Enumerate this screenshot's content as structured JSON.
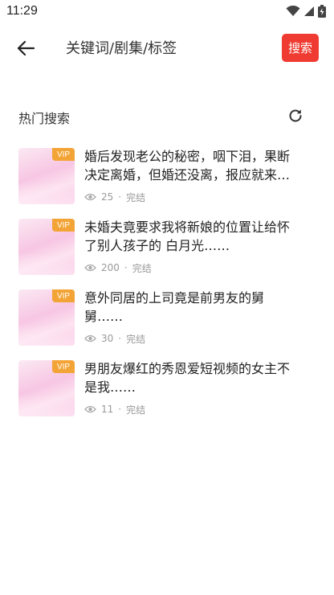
{
  "status": {
    "time": "11:29",
    "icons": [
      "wifi-icon",
      "signal-icon",
      "battery-icon"
    ]
  },
  "search": {
    "placeholder": "关键词/剧集/标签",
    "button_label": "搜索",
    "accent_color": "#ef3b32"
  },
  "hot": {
    "title": "热门搜索",
    "items": [
      {
        "title": "婚后发现老公的秘密，咽下泪，果断决定离婚，但婚还没离，报应就来…",
        "views": "25",
        "sep": "·",
        "status": "完结",
        "badge": "VIP"
      },
      {
        "title": "未婚夫竟要求我将新娘的位置让给怀了别人孩子的 白月光……",
        "views": "200",
        "sep": "·",
        "status": "完结",
        "badge": "VIP"
      },
      {
        "title": "意外同居的上司竟是前男友的舅舅……",
        "views": "30",
        "sep": "·",
        "status": "完结",
        "badge": "VIP"
      },
      {
        "title": "男朋友爆红的秀恩爱短视频的女主不是我……",
        "views": "11",
        "sep": "·",
        "status": "完结",
        "badge": "VIP"
      }
    ]
  }
}
